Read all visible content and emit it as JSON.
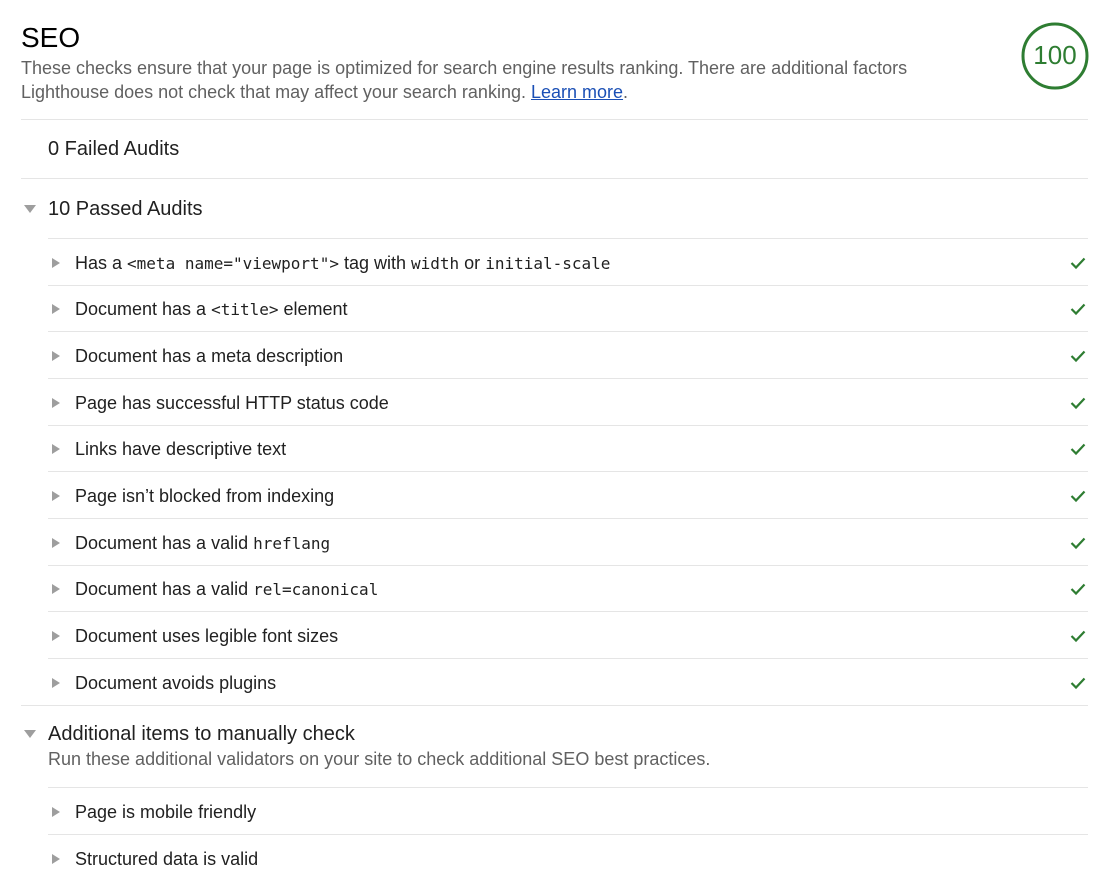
{
  "category": {
    "title": "SEO",
    "description": "These checks ensure that your page is optimized for search engine results ranking. There are additional factors Lighthouse does not check that may affect your search ranking.",
    "learn_more": "Learn more",
    "trailing_period": ".",
    "score": "100",
    "score_fraction": 1.0,
    "score_color": "#2e7d32"
  },
  "failed_group": {
    "title": "0 Failed Audits"
  },
  "passed_group": {
    "title": "10 Passed Audits",
    "audits": [
      {
        "parts": [
          [
            "t",
            "Has a "
          ],
          [
            "c",
            "<meta name=\"viewport\">"
          ],
          [
            "t",
            " tag with "
          ],
          [
            "c",
            "width"
          ],
          [
            "t",
            " or "
          ],
          [
            "c",
            "initial-scale"
          ]
        ],
        "status": "pass"
      },
      {
        "parts": [
          [
            "t",
            "Document has a "
          ],
          [
            "c",
            "<title>"
          ],
          [
            "t",
            " element"
          ]
        ],
        "status": "pass"
      },
      {
        "parts": [
          [
            "t",
            "Document has a meta description"
          ]
        ],
        "status": "pass"
      },
      {
        "parts": [
          [
            "t",
            "Page has successful HTTP status code"
          ]
        ],
        "status": "pass"
      },
      {
        "parts": [
          [
            "t",
            "Links have descriptive text"
          ]
        ],
        "status": "pass"
      },
      {
        "parts": [
          [
            "t",
            "Page isn’t blocked from indexing"
          ]
        ],
        "status": "pass"
      },
      {
        "parts": [
          [
            "t",
            "Document has a valid "
          ],
          [
            "c",
            "hreflang"
          ]
        ],
        "status": "pass"
      },
      {
        "parts": [
          [
            "t",
            "Document has a valid "
          ],
          [
            "c",
            "rel=canonical"
          ]
        ],
        "status": "pass"
      },
      {
        "parts": [
          [
            "t",
            "Document uses legible font sizes"
          ]
        ],
        "status": "pass"
      },
      {
        "parts": [
          [
            "t",
            "Document avoids plugins"
          ]
        ],
        "status": "pass"
      }
    ]
  },
  "manual_group": {
    "title": "Additional items to manually check",
    "description": "Run these additional validators on your site to check additional SEO best practices.",
    "audits": [
      {
        "parts": [
          [
            "t",
            "Page is mobile friendly"
          ]
        ]
      },
      {
        "parts": [
          [
            "t",
            "Structured data is valid"
          ]
        ]
      }
    ]
  },
  "icons": {
    "pass": "checkmark-icon",
    "expand": "triangle-right-icon",
    "collapse": "triangle-down-icon"
  },
  "colors": {
    "pass": "#2e7d32",
    "link": "#1a4fb5",
    "text_secondary": "#616161"
  }
}
